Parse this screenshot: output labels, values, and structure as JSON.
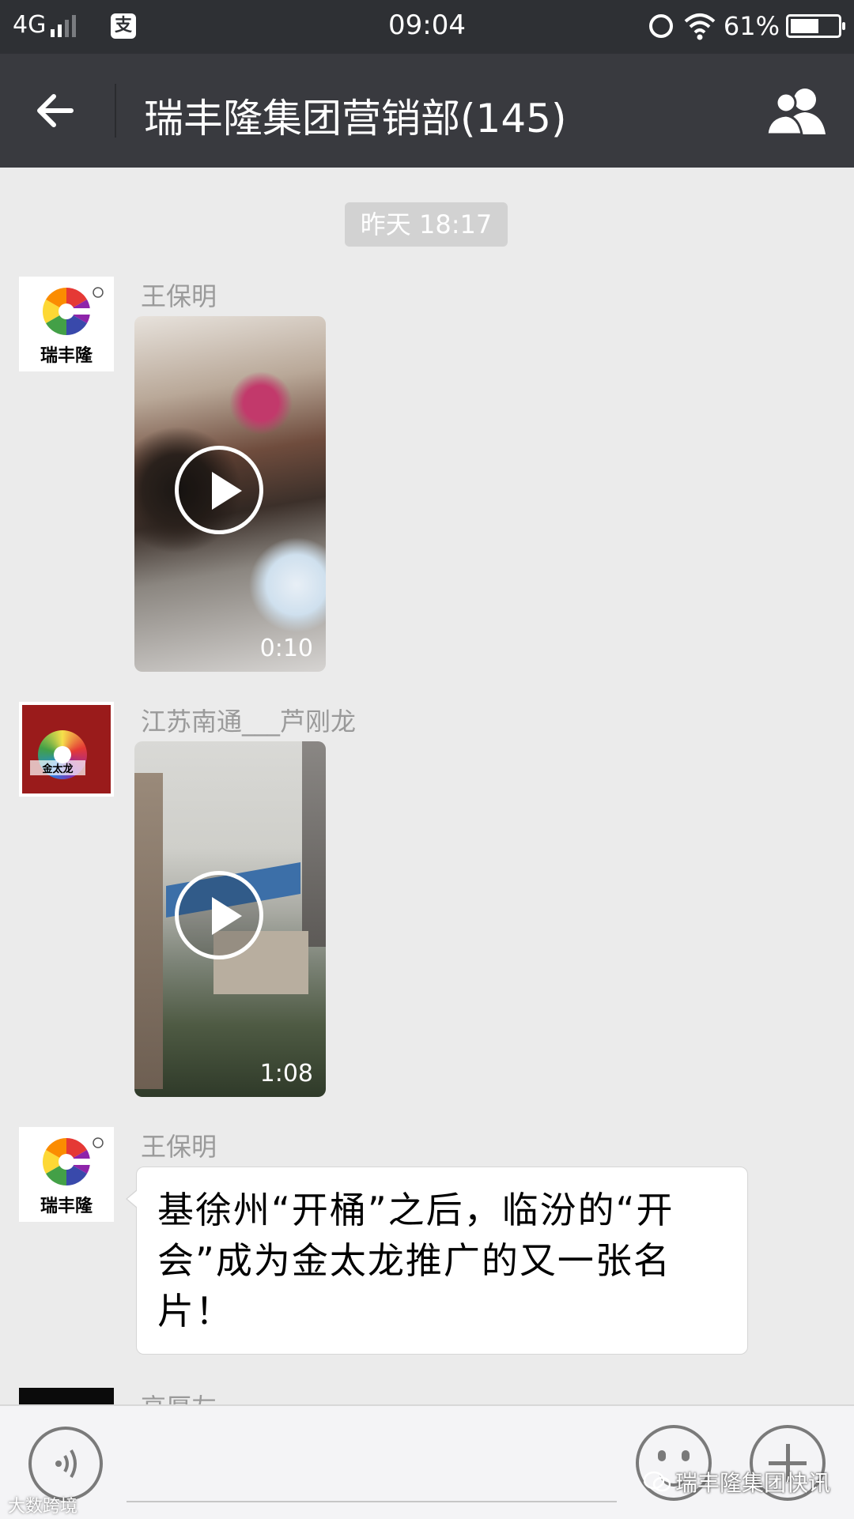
{
  "status_bar": {
    "network": "4G",
    "time": "09:04",
    "battery": "61%",
    "battery_level": 0.61,
    "alipay_glyph": "支"
  },
  "header": {
    "title": "瑞丰隆集团营销部(145)",
    "back_icon": "back-arrow-icon",
    "members_icon": "group-members-icon"
  },
  "chat": {
    "timestamp": "昨天 18:17",
    "messages": [
      {
        "sender": "王保明",
        "type": "video",
        "duration": "0:10",
        "avatar_text": "瑞丰隆"
      },
      {
        "sender": "江苏南通___芦刚龙",
        "type": "video",
        "duration": "1:08",
        "avatar_text": "金太龙"
      },
      {
        "sender": "王保明",
        "type": "text",
        "text": "基徐州“开桶”之后，临汾的“开会”成为金太龙推广的又一张名片！",
        "avatar_text": "瑞丰隆"
      },
      {
        "sender": "高厚友",
        "type": "partial"
      }
    ]
  },
  "input_bar": {
    "voice_icon": "voice-icon",
    "emoji_icon": "emoji-icon",
    "plus_icon": "plus-icon"
  },
  "watermarks": {
    "right": "瑞丰隆集团快讯",
    "left": "大数跨境"
  }
}
